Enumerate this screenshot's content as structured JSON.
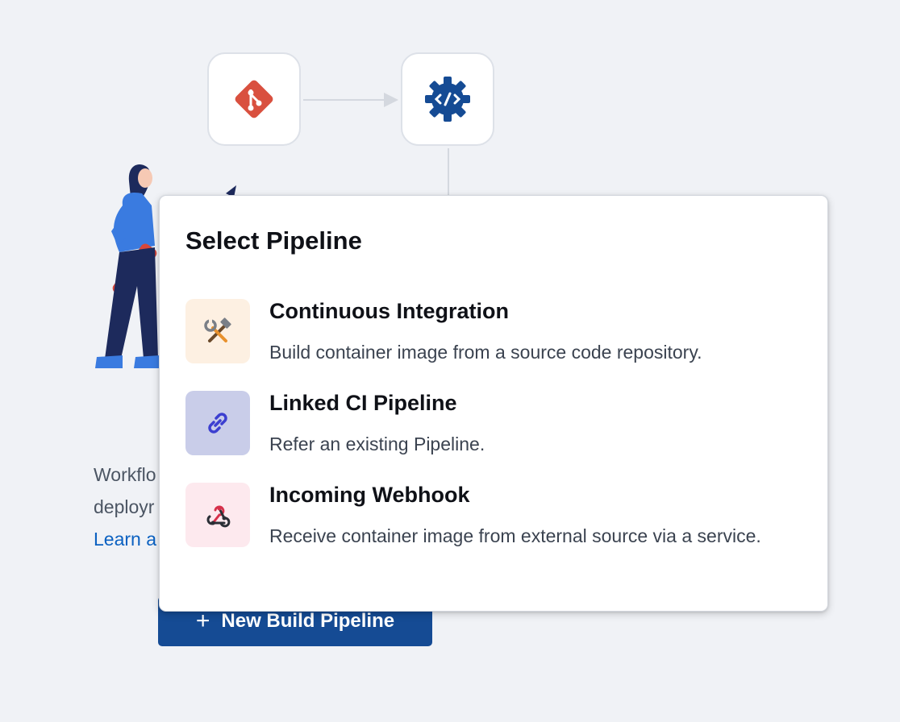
{
  "background": {
    "text_line1": "Workflo",
    "text_line2": "deployr",
    "learn_link": "Learn a",
    "new_build_button": {
      "icon": "+",
      "label": "New Build Pipeline"
    }
  },
  "flow_nodes": [
    {
      "icon": "git-icon"
    },
    {
      "icon": "code-gear-icon"
    }
  ],
  "popup": {
    "title": "Select Pipeline",
    "options": [
      {
        "title": "Continuous Integration",
        "description": "Build container image from a source code repository.",
        "icon": "tools-icon",
        "icon_bg": "#fdf0e2"
      },
      {
        "title": "Linked CI Pipeline",
        "description": "Refer an existing Pipeline.",
        "icon": "link-icon",
        "icon_bg": "#c9cde9"
      },
      {
        "title": "Incoming Webhook",
        "description": "Receive container image from external source via a service.",
        "icon": "webhook-icon",
        "icon_bg": "#fde9ee"
      }
    ]
  },
  "colors": {
    "page_bg": "#f0f2f6",
    "button_bg": "#154b94",
    "link": "#0b61c1",
    "git_icon": "#d9503f",
    "code_gear_icon": "#154b94"
  }
}
